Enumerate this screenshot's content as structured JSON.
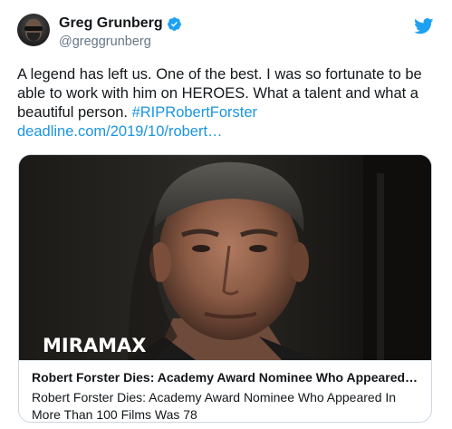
{
  "author": {
    "display_name": "Greg Grunberg",
    "handle": "@greggrunberg",
    "verified": true
  },
  "tweet": {
    "text": "A legend has left us. One of the best. I was so fortunate to be able to work with him on HEROES. What a talent and what a beautiful person. ",
    "hashtag": "#RIPRobertForster",
    "link": "deadline.com/2019/10/robert…"
  },
  "card": {
    "image_logo": "MIRAMAX",
    "title": "Robert Forster Dies: Academy Award Nominee Who Appeared…",
    "description": "Robert Forster Dies: Academy Award Nominee Who Appeared In More Than 100 Films Was 78"
  },
  "icons": {
    "verified": "verified-badge-icon",
    "platform": "twitter-bird-icon"
  },
  "colors": {
    "link": "#1b95e0",
    "verified": "#1da1f2",
    "handle": "#657786",
    "border": "#ccd6dd"
  }
}
